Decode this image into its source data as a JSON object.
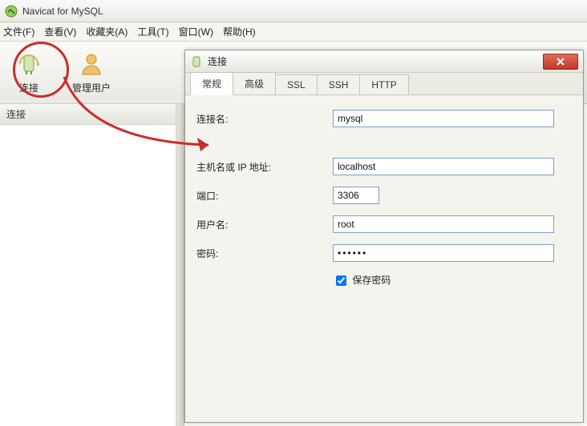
{
  "window": {
    "title": "Navicat for MySQL"
  },
  "menu": {
    "file": "文件(F)",
    "view": "查看(V)",
    "favorites": "收藏夹(A)",
    "tools": "工具(T)",
    "window": "窗口(W)",
    "help": "帮助(H)"
  },
  "toolbar": {
    "connect": "连接",
    "manage_user": "管理用户"
  },
  "sidebar": {
    "title": "连接"
  },
  "dialog": {
    "title": "连接",
    "tabs": {
      "general": "常规",
      "advanced": "高级",
      "ssl": "SSL",
      "ssh": "SSH",
      "http": "HTTP"
    },
    "labels": {
      "conn_name": "连接名:",
      "host": "主机名或 IP 地址:",
      "port": "端口:",
      "user": "用户名:",
      "password": "密码:"
    },
    "values": {
      "conn_name": "mysql",
      "host": "localhost",
      "port": "3306",
      "user": "root",
      "password": "••••••"
    },
    "save_pwd": "保存密码"
  }
}
